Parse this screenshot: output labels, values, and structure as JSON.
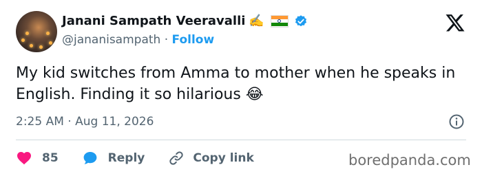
{
  "author": {
    "display_name": "Janani Sampath Veeravalli",
    "name_emoji": "✍️",
    "handle": "@jananisampath",
    "separator": "·",
    "follow_label": "Follow"
  },
  "tweet": {
    "text": "My kid switches from Amma to mother when he speaks in English. Finding it so hilarious",
    "trailing_emoji": "😂",
    "time": "2:25 AM",
    "separator": "·",
    "date": "Aug 11, 2026"
  },
  "actions": {
    "like_count": "85",
    "reply_label": "Reply",
    "copy_link_label": "Copy link"
  },
  "watermark": "boredpanda.com",
  "icons": {
    "logo": "x-logo-icon",
    "verified": "verified-badge-icon",
    "flag": "india-flag-icon",
    "info": "info-icon",
    "like": "heart-icon",
    "reply": "speech-bubble-icon",
    "copy_link": "link-icon"
  },
  "colors": {
    "accent": "#1d9bf0",
    "heart": "#f91880",
    "secondary_text": "#536471",
    "primary_text": "#0f1419"
  }
}
